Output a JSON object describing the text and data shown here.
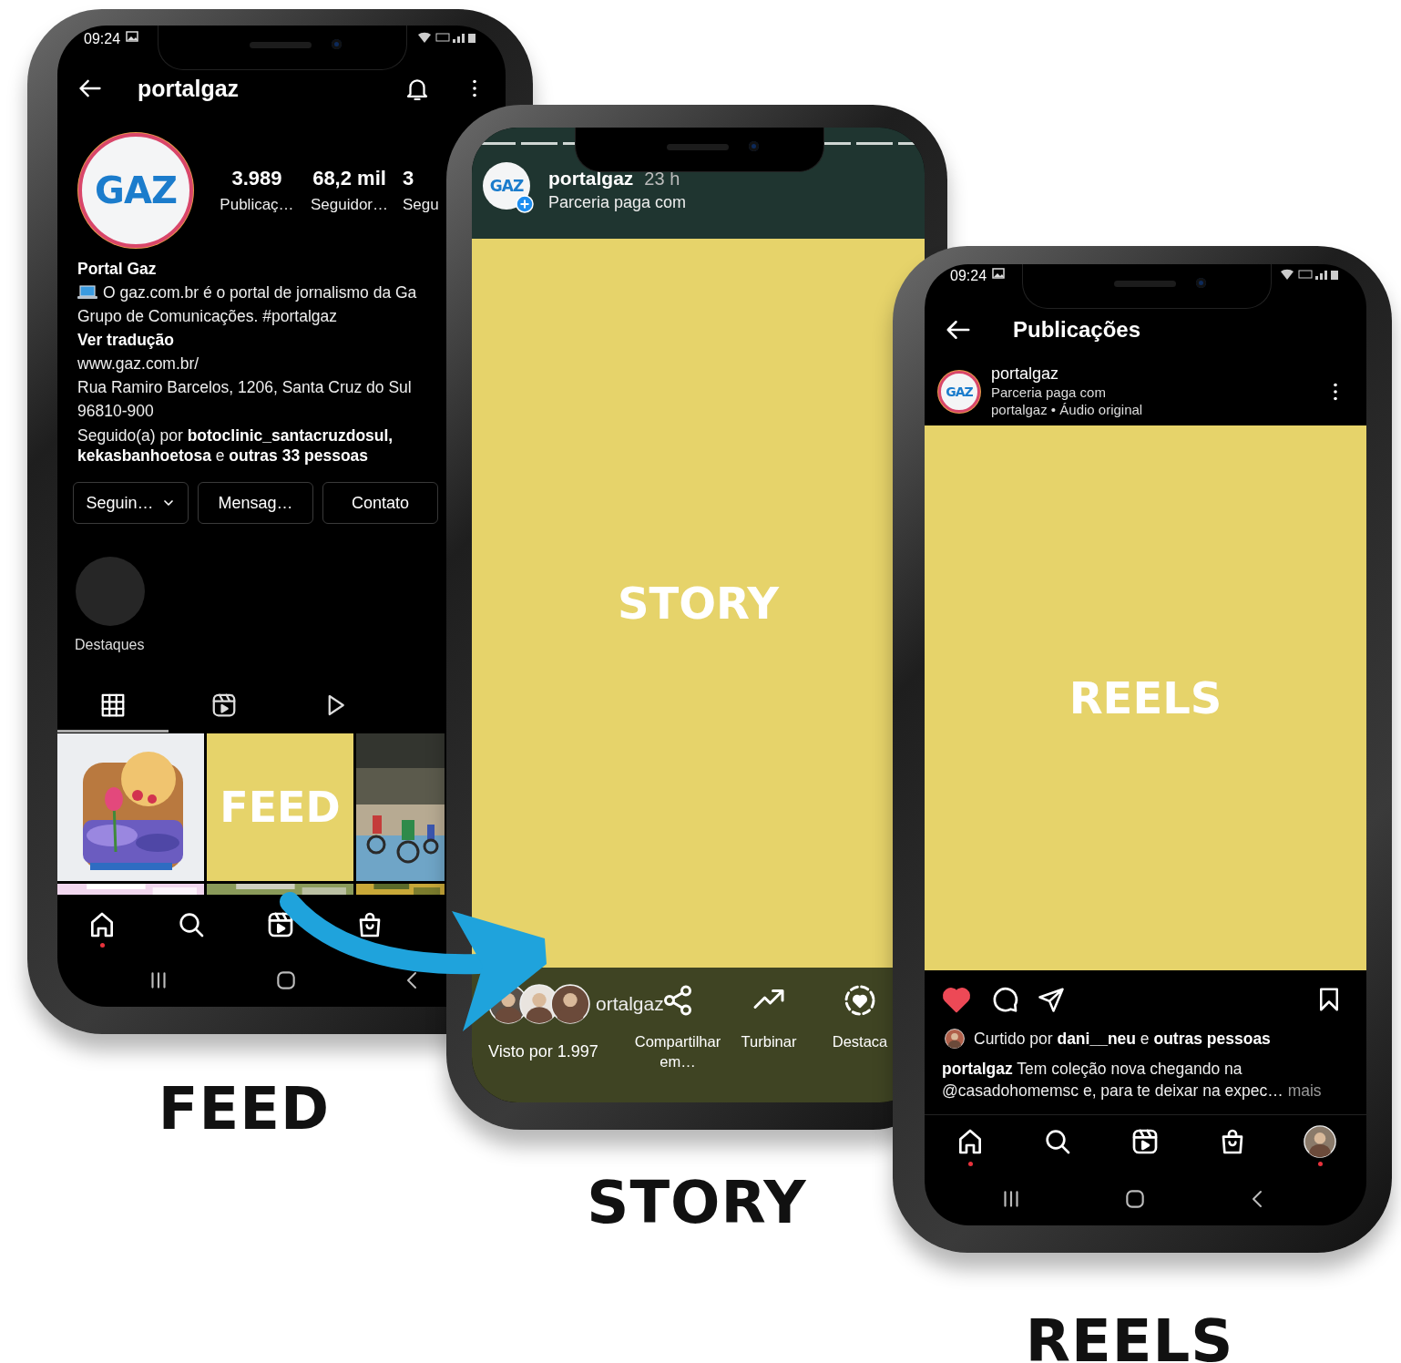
{
  "phones": [
    {
      "kind": "feed",
      "status_time": "09:24",
      "username": "portalgaz",
      "avatar_logo": "GAZ",
      "stats": [
        {
          "value": "3.989",
          "label": "Publicaç…"
        },
        {
          "value": "68,2 mil",
          "label": "Seguidor…"
        },
        {
          "value": "3",
          "label": "Segu"
        }
      ],
      "name": "Portal Gaz",
      "bio": [
        "O gaz.com.br é o portal de jornalismo da Ga",
        "Grupo de Comunicações. #portalgaz"
      ],
      "translate": "Ver tradução",
      "website": "www.gaz.com.br/",
      "address": [
        "Rua Ramiro Barcelos, 1206, Santa Cruz do Sul",
        "96810-900"
      ],
      "followed_by": "Seguido(a) por **botoclinic_santacruzdosul,** **kekasbanhoetosa** e **outras 33 pessoas**",
      "buttons": [
        {
          "label": "Seguin…",
          "dropdown": true
        },
        {
          "label": "Mensag…",
          "dropdown": false
        },
        {
          "label": "Contato",
          "dropdown": false
        }
      ],
      "highlights": [
        {
          "label": "Destaques"
        }
      ],
      "tabs": [
        {
          "selected": true
        },
        {
          "selected": false
        },
        {
          "selected": false
        }
      ],
      "grid": [
        {
          "kind": "picture"
        },
        {
          "kind": "label",
          "text": "FEED"
        },
        {
          "kind": "picture"
        },
        {
          "kind": "picture"
        },
        {
          "kind": "picture"
        },
        {
          "kind": "picture"
        }
      ],
      "nav": [
        {
          "dot": true
        },
        {
          "dot": false
        },
        {
          "dot": false
        },
        {
          "dot": false
        }
      ]
    },
    {
      "kind": "story",
      "progress": {
        "level": 1
      },
      "avatar_logo": "GAZ",
      "username": "portalgaz",
      "time": "23 h",
      "subtitle": "Parceria paga com",
      "content_label": "STORY",
      "viewers_name": "ortalgaz",
      "views": "Visto por 1.997",
      "actions": [
        {
          "label": "Compartilhar em…"
        },
        {
          "label": "Turbinar"
        },
        {
          "label": "Destaca"
        }
      ]
    },
    {
      "kind": "reels",
      "status_time": "09:24",
      "title": "Publicações",
      "avatar_logo": "GAZ",
      "username": "portalgaz",
      "subtitle": "Parceria paga com",
      "audio": "portalgaz • Áudio original",
      "content_label": "REELS",
      "liked": true,
      "liked_by": "Curtido por **dani__neu** e **outras pessoas**",
      "caption": "**portalgaz** Tem coleção nova chegando na @casadohomemsc e, para te deixar na expec…",
      "more": "mais",
      "nav": [
        {
          "dot": true
        },
        {
          "dot": false
        },
        {
          "dot": false
        },
        {
          "dot": false
        },
        {
          "dot": true
        }
      ]
    }
  ],
  "captions": [
    "FEED",
    "STORY",
    "REELS"
  ]
}
